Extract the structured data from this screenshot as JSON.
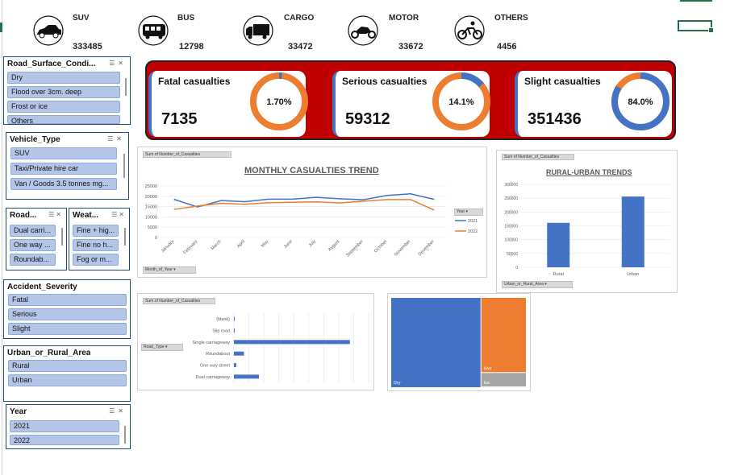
{
  "kpis": [
    {
      "label": "SUV",
      "value": "333485",
      "icon": "car-icon"
    },
    {
      "label": "BUS",
      "value": "12798",
      "icon": "bus-icon"
    },
    {
      "label": "CARGO",
      "value": "33472",
      "icon": "truck-icon"
    },
    {
      "label": "MOTOR",
      "value": "33672",
      "icon": "motorcycle-icon"
    },
    {
      "label": "OTHERS",
      "value": "4456",
      "icon": "bicycle-icon"
    }
  ],
  "slicers": {
    "road_surface": {
      "title": "Road_Surface_Condi...",
      "items": [
        "Dry",
        "Flood over 3cm. deep",
        "Frost or ice",
        "Others"
      ]
    },
    "vehicle_type": {
      "title": "Vehicle_Type",
      "items": [
        "SUV",
        "Taxi/Private hire car",
        "Van / Goods 3.5 tonnes mg..."
      ]
    },
    "road": {
      "title": "Road...",
      "items": [
        "Dual carri...",
        "One way ...",
        "Roundab..."
      ]
    },
    "weather": {
      "title": "Weat...",
      "items": [
        "Fine + hig...",
        "Fine no h...",
        "Fog or m..."
      ]
    },
    "severity": {
      "title": "Accident_Severity",
      "items": [
        "Fatal",
        "Serious",
        "Slight"
      ]
    },
    "urban_rural": {
      "title": "Urban_or_Rural_Area",
      "items": [
        "Rural",
        "Urban"
      ]
    },
    "year": {
      "title": "Year",
      "items": [
        "2021",
        "2022"
      ]
    }
  },
  "casualties": [
    {
      "title": "Fatal casualties",
      "value": "7135",
      "pct": "1.70%",
      "fraction": 0.017
    },
    {
      "title": "Serious casualties",
      "value": "59312",
      "pct": "14.1%",
      "fraction": 0.141
    },
    {
      "title": "Slight casualties",
      "value": "351436",
      "pct": "84.0%",
      "fraction": 0.84
    }
  ],
  "colors": {
    "blue": "#4472c4",
    "orange": "#ed7d31",
    "gray": "#a5a5a5",
    "red": "#c00000"
  },
  "chart_data": [
    {
      "type": "line",
      "title": "MONTHLY CASUALTIES TREND",
      "value_field": "Sum of Number_of_Casualties",
      "axis_field": "Month_of_Year",
      "legend_field": "Year",
      "legend": "right",
      "categories": [
        "January",
        "February",
        "March",
        "April",
        "May",
        "June",
        "July",
        "August",
        "September",
        "October",
        "November",
        "December"
      ],
      "series": [
        {
          "name": "2021",
          "color": "#4472c4",
          "values": [
            18500,
            14800,
            17900,
            17400,
            18600,
            18600,
            19500,
            18800,
            18300,
            20400,
            21200,
            18500
          ]
        },
        {
          "name": "2022",
          "color": "#ed7d31",
          "values": [
            13600,
            15300,
            16600,
            16100,
            16900,
            17100,
            17300,
            16800,
            17600,
            18400,
            18400,
            13300
          ]
        }
      ],
      "ylim": [
        0,
        25000
      ],
      "yticks": [
        0,
        5000,
        10000,
        15000,
        20000,
        25000
      ]
    },
    {
      "type": "bar",
      "title": "RURAL-URBAN TRENDS",
      "value_field": "Sum of Number_of_Casualties",
      "axis_field": "Urban_or_Rural_Area",
      "categories": [
        "Rural",
        "Urban"
      ],
      "values": [
        161000,
        256000
      ],
      "ylim": [
        0,
        300000
      ],
      "yticks": [
        0,
        50000,
        100000,
        150000,
        200000,
        250000,
        300000
      ]
    },
    {
      "type": "bar",
      "orientation": "horizontal",
      "value_field": "Sum of Number_of_Casualties",
      "axis_field": "Road_Type",
      "categories": [
        "(blank)",
        "Slip road",
        "Single carriageway",
        "Roundabout",
        "One way street",
        "Dual carriageway"
      ],
      "values": [
        700,
        1800,
        310000,
        27000,
        6000,
        67000
      ],
      "xlim": [
        0,
        360000
      ],
      "gridlines": [
        0,
        40000,
        80000,
        120000,
        160000,
        200000,
        240000,
        280000,
        320000,
        360000
      ]
    },
    {
      "type": "treemap",
      "items": [
        {
          "label": "Dry",
          "value": 279000,
          "color": "#4472c4"
        },
        {
          "label": "Wet",
          "value": 116000,
          "color": "#ed7d31"
        },
        {
          "label": "Ice",
          "value": 22000,
          "color": "#a5a5a5"
        }
      ]
    }
  ]
}
